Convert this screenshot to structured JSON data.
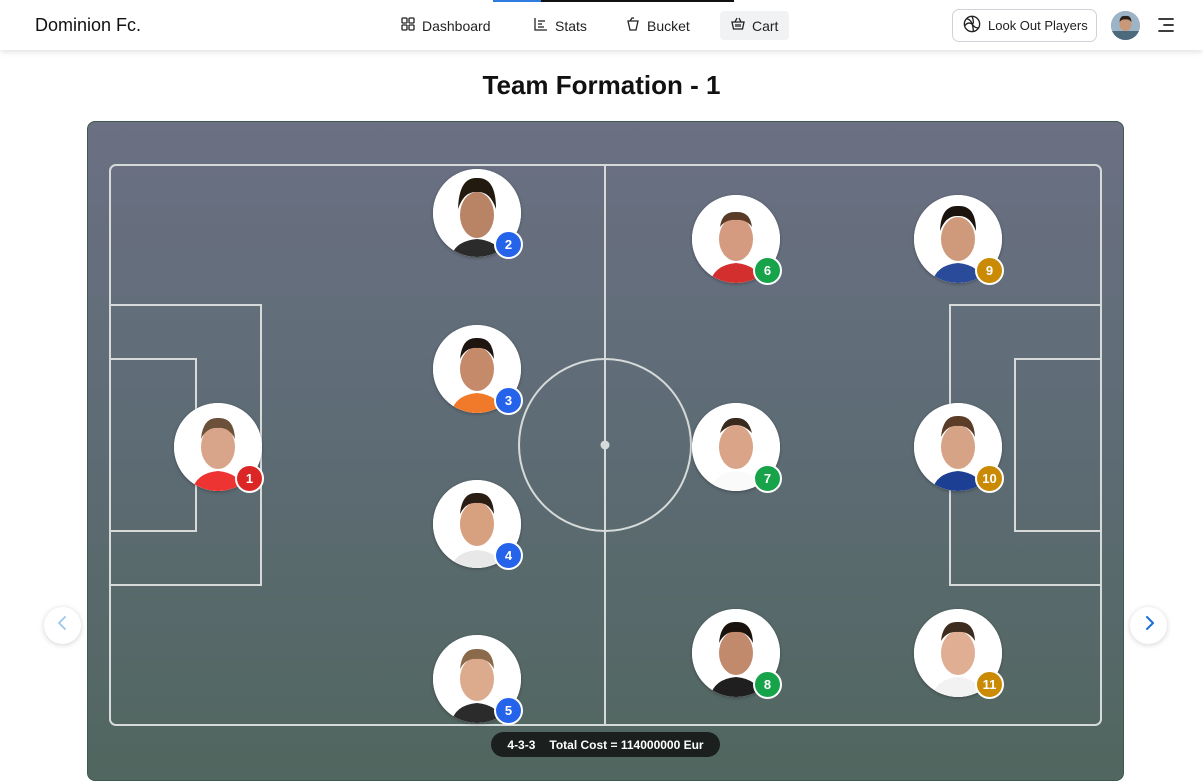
{
  "header": {
    "brand": "Dominion Fc.",
    "nav": [
      {
        "label": "Dashboard",
        "icon": "grid-icon"
      },
      {
        "label": "Stats",
        "icon": "bar-chart-icon"
      },
      {
        "label": "Bucket",
        "icon": "bucket-icon"
      },
      {
        "label": "Cart",
        "icon": "basket-icon",
        "active": true
      }
    ],
    "lookout_label": "Look Out Players",
    "lookout_icon": "volleyball-icon"
  },
  "page_title": "Team Formation - 1",
  "badge_colors": {
    "goalkeeper": "#dc2626",
    "defender": "#2563eb",
    "midfielder": "#16a34a",
    "forward": "#ca8a04"
  },
  "players": [
    {
      "number": "1",
      "role": "goalkeeper"
    },
    {
      "number": "2",
      "role": "defender"
    },
    {
      "number": "3",
      "role": "defender"
    },
    {
      "number": "4",
      "role": "defender"
    },
    {
      "number": "5",
      "role": "defender"
    },
    {
      "number": "6",
      "role": "midfielder"
    },
    {
      "number": "7",
      "role": "midfielder"
    },
    {
      "number": "8",
      "role": "midfielder"
    },
    {
      "number": "9",
      "role": "forward"
    },
    {
      "number": "10",
      "role": "forward"
    },
    {
      "number": "11",
      "role": "forward"
    }
  ],
  "summary": {
    "formation": "4-3-3",
    "total_cost": "Total Cost = 114000000 Eur"
  }
}
